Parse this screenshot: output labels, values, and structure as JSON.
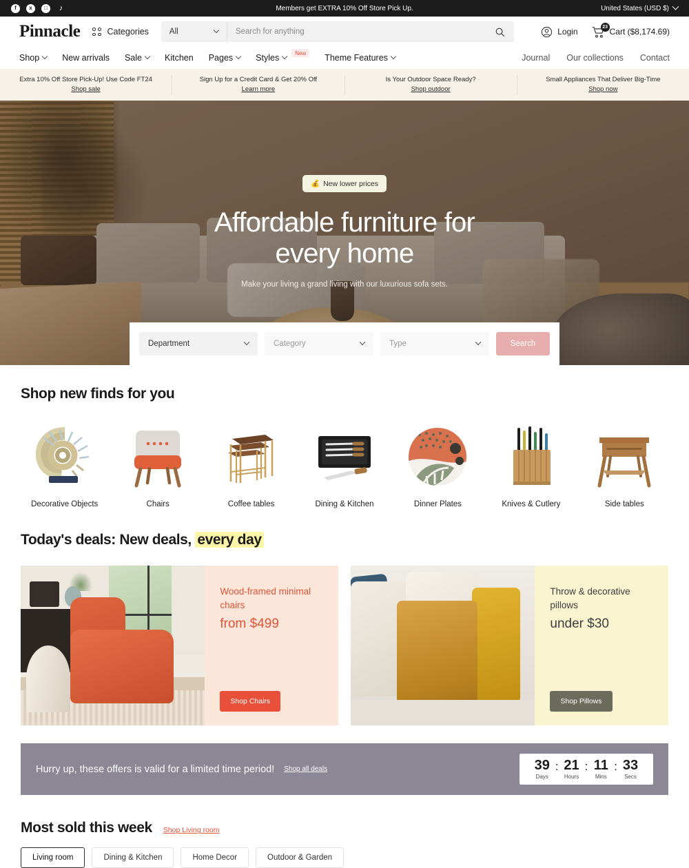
{
  "topbar": {
    "social": [
      {
        "name": "facebook-icon",
        "glyph": "f"
      },
      {
        "name": "x-icon",
        "glyph": "x"
      },
      {
        "name": "instagram-icon",
        "glyph": "□"
      },
      {
        "name": "tiktok-icon",
        "glyph": "♪"
      }
    ],
    "message": "Members get EXTRA 10% Off Store Pick Up.",
    "locale": "United States (USD $)"
  },
  "header": {
    "logo": "Pinnacle",
    "categories_label": "Categories",
    "search": {
      "scope": "All",
      "placeholder": "Search for anything",
      "value": ""
    },
    "login_label": "Login",
    "cart_label": "Cart ($8,174.69)",
    "cart_count": "23"
  },
  "nav": {
    "left": [
      {
        "label": "Shop",
        "has_caret": true,
        "badge": ""
      },
      {
        "label": "New arrivals",
        "has_caret": false,
        "badge": ""
      },
      {
        "label": "Sale",
        "has_caret": true,
        "badge": ""
      },
      {
        "label": "Kitchen",
        "has_caret": false,
        "badge": ""
      },
      {
        "label": "Pages",
        "has_caret": true,
        "badge": ""
      },
      {
        "label": "Styles",
        "has_caret": true,
        "badge": "New"
      },
      {
        "label": "Theme Features",
        "has_caret": true,
        "badge": ""
      }
    ],
    "right": [
      "Journal",
      "Our collections",
      "Contact"
    ]
  },
  "announcements": [
    {
      "text": "Extra 10% Off Store Pick-Up! Use Code FT24",
      "link": "Shop sale"
    },
    {
      "text": "Sign Up for a Credit Card & Get 20% Off",
      "link": "Learn more"
    },
    {
      "text": "Is Your Outdoor Space Ready?",
      "link": "Shop outdoor"
    },
    {
      "text": "Small Appliances That Deliver Big-Time",
      "link": "Shop now"
    }
  ],
  "hero": {
    "badge_icon": "💰",
    "badge": "New lower prices",
    "headline_line1": "Affordable furniture for",
    "headline_line2": "every home",
    "subhead": "Make your living a grand living with our luxurious sofa sets.",
    "form": {
      "department": "Department",
      "category": "Category",
      "type": "Type",
      "search_button": "Search"
    }
  },
  "new_finds": {
    "title": "Shop new finds for you",
    "items": [
      {
        "label": "Decorative Objects",
        "icon": "ammonite-shell-sculpture"
      },
      {
        "label": "Chairs",
        "icon": "upholstered-accent-chair"
      },
      {
        "label": "Coffee tables",
        "icon": "nesting-coffee-tables"
      },
      {
        "label": "Dining & Kitchen",
        "icon": "knife-set-case"
      },
      {
        "label": "Dinner Plates",
        "icon": "patterned-dinner-plate"
      },
      {
        "label": "Knives & Cutlery",
        "icon": "knife-block"
      },
      {
        "label": "Side tables",
        "icon": "wooden-side-table"
      }
    ]
  },
  "deals": {
    "title_plain": "Today's deals: New deals,",
    "title_highlight": "every day",
    "cards": [
      {
        "title": "Wood-framed minimal chairs",
        "price": "from $499",
        "button": "Shop Chairs",
        "bg": "#fce5d9",
        "accent": "#e0553a",
        "button_bg": "#e8503a",
        "image": "orange-accent-chair-room"
      },
      {
        "title": "Throw & decorative pillows",
        "price": "under $30",
        "button": "Shop Pillows",
        "bg": "#faf5d0",
        "accent": "#3d3d3d",
        "button_bg": "#6c6c5c",
        "image": "gold-throw-pillows"
      }
    ]
  },
  "countdown": {
    "text": "Hurry up, these offers is valid for a limited time period!",
    "link": "Shop all deals",
    "units": [
      {
        "value": "39",
        "label": "Days"
      },
      {
        "value": "21",
        "label": "Hours"
      },
      {
        "value": "11",
        "label": "Mins"
      },
      {
        "value": "33",
        "label": "Secs"
      }
    ],
    "separator": ":",
    "bg": "#8b8795"
  },
  "most_sold": {
    "title": "Most sold this week",
    "link": "Shop Living room",
    "tabs": [
      {
        "label": "Living room",
        "active": true
      },
      {
        "label": "Dining & Kitchen",
        "active": false
      },
      {
        "label": "Home Decor",
        "active": false
      },
      {
        "label": "Outdoor & Garden",
        "active": false
      }
    ]
  }
}
